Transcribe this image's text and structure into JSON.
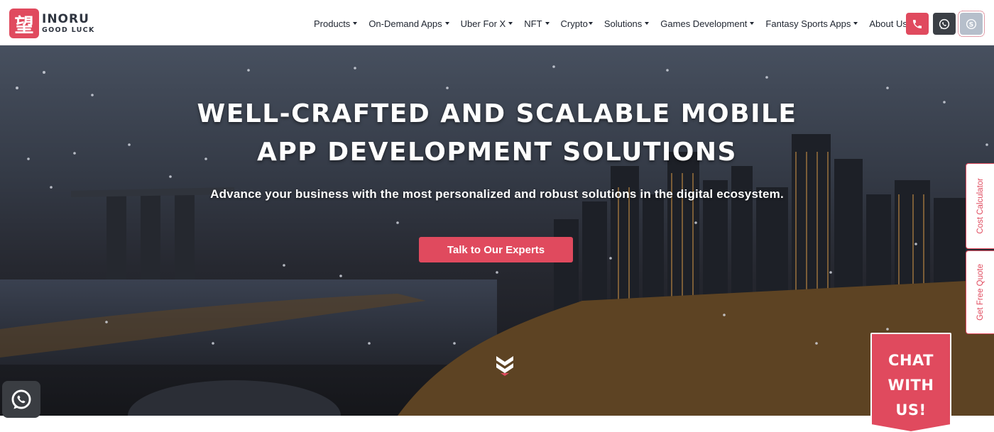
{
  "brand": {
    "logo_glyph": "望",
    "name": "INORU",
    "tagline": "GOOD LUCK",
    "accent_color": "#e04a5e"
  },
  "nav": {
    "items": [
      {
        "label": "Products",
        "dropdown": true
      },
      {
        "label": "On-Demand Apps",
        "dropdown": true
      },
      {
        "label": "Uber For X",
        "dropdown": true
      },
      {
        "label": "NFT",
        "dropdown": true
      },
      {
        "label": "Crypto",
        "dropdown": true
      },
      {
        "label": "Solutions",
        "dropdown": true
      },
      {
        "label": "Games Development",
        "dropdown": true
      },
      {
        "label": "Fantasy Sports Apps",
        "dropdown": true
      },
      {
        "label": "About Us",
        "dropdown": false
      }
    ],
    "icons": [
      "phone-icon",
      "whatsapp-icon",
      "skype-icon"
    ]
  },
  "hero": {
    "title_line1": "WELL-CRAFTED AND SCALABLE MOBILE",
    "title_line2": "APP DEVELOPMENT SOLUTIONS",
    "subtitle": "Advance your business with the most personalized and robust solutions in the digital ecosystem.",
    "cta_label": "Talk to Our Experts",
    "scroll_icon": "double-chevron-down-icon"
  },
  "side_tabs": {
    "cost_calculator": "Cost Calculator",
    "free_quote": "Get Free Quote"
  },
  "chat": {
    "line1": "CHAT",
    "line2": "WITH",
    "line3": "US!"
  },
  "floating": {
    "whatsapp_icon": "whatsapp-icon"
  }
}
